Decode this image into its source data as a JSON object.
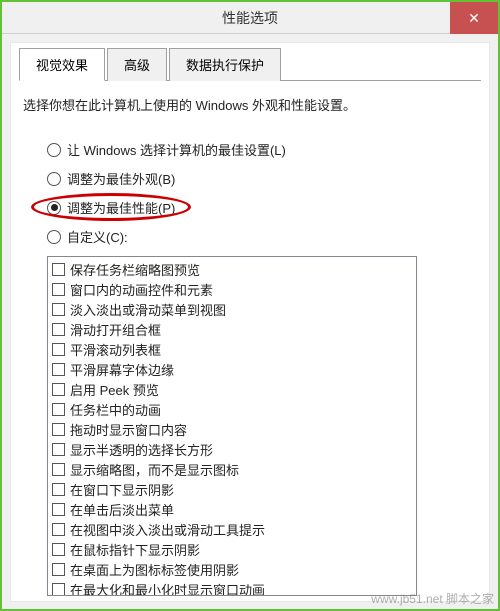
{
  "window": {
    "title": "性能选项"
  },
  "tabs": [
    {
      "label": "视觉效果",
      "active": true
    },
    {
      "label": "高级",
      "active": false
    },
    {
      "label": "数据执行保护",
      "active": false
    }
  ],
  "intro": "选择你想在此计算机上使用的 Windows 外观和性能设置。",
  "radios": [
    {
      "label": "让 Windows 选择计算机的最佳设置(L)",
      "checked": false,
      "highlight": false
    },
    {
      "label": "调整为最佳外观(B)",
      "checked": false,
      "highlight": false
    },
    {
      "label": "调整为最佳性能(P)",
      "checked": true,
      "highlight": true
    },
    {
      "label": "自定义(C):",
      "checked": false,
      "highlight": false
    }
  ],
  "checklist": [
    "保存任务栏缩略图预览",
    "窗口内的动画控件和元素",
    "淡入淡出或滑动菜单到视图",
    "滑动打开组合框",
    "平滑滚动列表框",
    "平滑屏幕字体边缘",
    "启用 Peek 预览",
    "任务栏中的动画",
    "拖动时显示窗口内容",
    "显示半透明的选择长方形",
    "显示缩略图，而不是显示图标",
    "在窗口下显示阴影",
    "在单击后淡出菜单",
    "在视图中淡入淡出或滑动工具提示",
    "在鼠标指针下显示阴影",
    "在桌面上为图标标签使用阴影",
    "在最大化和最小化时显示窗口动画"
  ],
  "watermark": "www.jb51.net 脚本之家"
}
